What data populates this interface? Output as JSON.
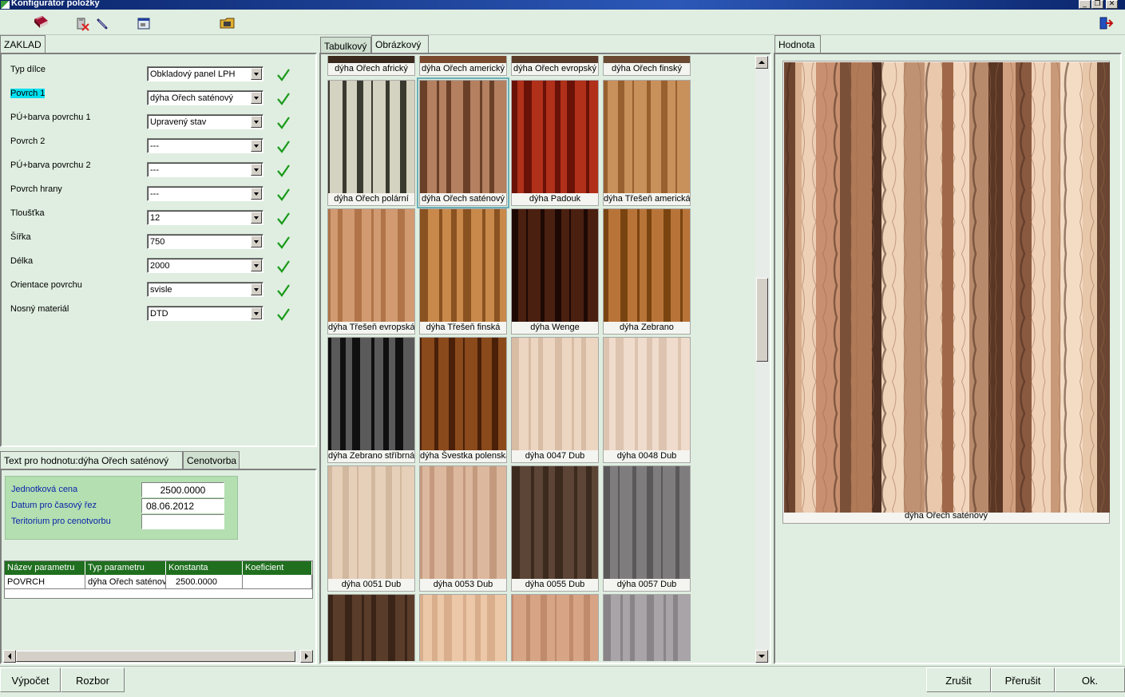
{
  "window": {
    "title": "Konfigurátor položky"
  },
  "left_tab": "ZAKLAD",
  "params": [
    {
      "label": "Typ dílce",
      "value": "Obkladový panel LPH"
    },
    {
      "label": "Povrch 1",
      "value": "dýha Ořech saténový"
    },
    {
      "label": "PÚ+barva povrchu 1",
      "value": "Upravený stav"
    },
    {
      "label": "Povrch 2",
      "value": "---"
    },
    {
      "label": "PÚ+barva povrchu 2",
      "value": "---"
    },
    {
      "label": "Povrch hrany",
      "value": "---"
    },
    {
      "label": "Tloušťka",
      "value": "12"
    },
    {
      "label": "Šířka",
      "value": "750"
    },
    {
      "label": "Délka",
      "value": "2000"
    },
    {
      "label": "Orientace povrchu",
      "value": "svisle"
    },
    {
      "label": "Nosný materiál",
      "value": "DTD"
    }
  ],
  "lower_tabs": [
    "Text pro hodnotu:dýha Ořech saténový",
    "Cenotvorba"
  ],
  "price": {
    "unit_price_label": "Jednotková cena",
    "unit_price": "2500.0000",
    "date_label": "Datum pro časový řez",
    "date": "08.06.2012",
    "territory_label": "Teritorium pro cenotvorbu",
    "territory": ""
  },
  "param_table": {
    "headers": [
      "Název parametru",
      "Typ parametru",
      "Konstanta",
      "Koeficient"
    ],
    "rows": [
      [
        "POVRCH",
        "dýha Ořech saténový",
        "2500.0000",
        ""
      ]
    ]
  },
  "middle_tabs": [
    "Tabulkový",
    "Obrázkový"
  ],
  "top_row_captions": [
    "dýha Ořech africký",
    "dýha Ořech americký",
    "dýha Ořech evropský",
    "dýha Ořech finský"
  ],
  "thumbnails": [
    {
      "caption": "dýha Ořech polární",
      "color": "#d4d2c0",
      "dark": "#3a3a30"
    },
    {
      "caption": "dýha Ořech saténový",
      "color": "#b48060",
      "dark": "#6a4028"
    },
    {
      "caption": "dýha Padouk",
      "color": "#b0301a",
      "dark": "#6a1208"
    },
    {
      "caption": "dýha Třešeň americká",
      "color": "#c8905a",
      "dark": "#98602e"
    },
    {
      "caption": "dýha Třešeň evropská",
      "color": "#d29a70",
      "dark": "#b07448"
    },
    {
      "caption": "dýha Třešeň finská",
      "color": "#c8894a",
      "dark": "#8a5220"
    },
    {
      "caption": "dýha Wenge",
      "color": "#4a2010",
      "dark": "#1e0804"
    },
    {
      "caption": "dýha Zebrano",
      "color": "#b87438",
      "dark": "#7a4410"
    },
    {
      "caption": "dýha Zebrano stříbrná",
      "color": "#5a5a5a",
      "dark": "#101010"
    },
    {
      "caption": "dýha Švestka polenská",
      "color": "#8a4a1c",
      "dark": "#4a2008"
    },
    {
      "caption": "dýha 0047 Dub",
      "color": "#ecd6c2",
      "dark": "#d8bca4"
    },
    {
      "caption": "dýha 0048 Dub",
      "color": "#f0dccc",
      "dark": "#dcc4b0"
    },
    {
      "caption": "dýha 0051 Dub",
      "color": "#e6d0ba",
      "dark": "#d2b89e"
    },
    {
      "caption": "dýha 0053 Dub",
      "color": "#dcb89e",
      "dark": "#c49a7e"
    },
    {
      "caption": "dýha 0055 Dub",
      "color": "#5c4536",
      "dark": "#3c2a1e"
    },
    {
      "caption": "dýha 0057 Dub",
      "color": "#7e7c7c",
      "dark": "#5a5858"
    },
    {
      "caption": "",
      "color": "#5a3c2a",
      "dark": "#3a2418"
    },
    {
      "caption": "",
      "color": "#ecc8a8",
      "dark": "#d8ae8c"
    },
    {
      "caption": "",
      "color": "#d8a486",
      "dark": "#c08a6c"
    },
    {
      "caption": "",
      "color": "#a8a4a8",
      "dark": "#888488"
    }
  ],
  "right_tab": "Hodnota",
  "preview_caption": "dýha Ořech saténový",
  "buttons": {
    "calc": "Výpočet",
    "analysis": "Rozbor",
    "cancel": "Zrušit",
    "interrupt": "Přerušit",
    "ok": "Ok."
  }
}
